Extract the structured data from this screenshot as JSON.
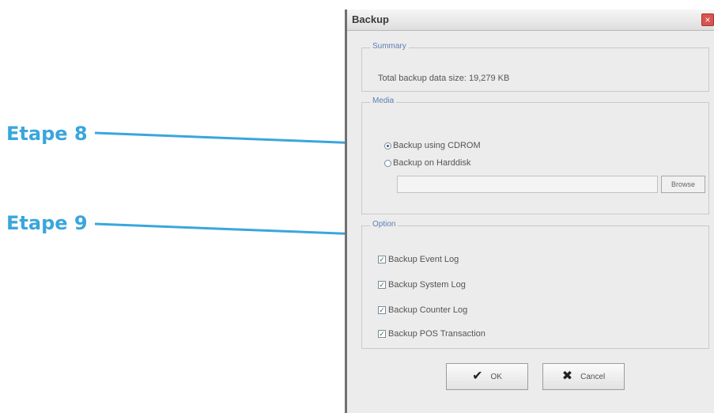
{
  "annotations": {
    "step8": "Etape 8",
    "step9": "Etape 9",
    "color": "#3aa6dd"
  },
  "dialog": {
    "title": "Backup",
    "close_glyph": "×",
    "summary": {
      "title": "Summary",
      "text": "Total backup data size: 19,279 KB"
    },
    "media": {
      "title": "Media",
      "option_cdrom": "Backup using CDROM",
      "option_harddisk": "Backup on Harddisk",
      "selected": "Backup using CDROM",
      "path_value": "",
      "browse_label": "Browse"
    },
    "option": {
      "title": "Option",
      "items": [
        "Backup Event Log",
        "Backup System Log",
        "Backup Counter Log",
        "Backup POS Transaction"
      ],
      "checked": [
        true,
        true,
        true,
        true
      ]
    },
    "ok_label": "OK",
    "cancel_label": "Cancel"
  },
  "icons": {
    "ok": "check-icon",
    "cancel": "x-icon",
    "close": "close-icon"
  }
}
